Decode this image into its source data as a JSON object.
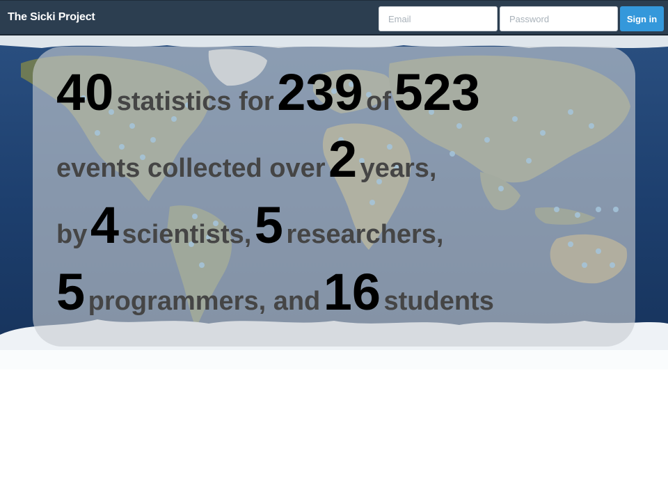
{
  "navbar": {
    "brand": "The Sicki Project",
    "email_placeholder": "Email",
    "password_placeholder": "Password",
    "signin_label": "Sign in"
  },
  "stats": {
    "line1": {
      "n1": "40",
      "t1": "statistics for",
      "n2": "239",
      "t2": "of",
      "n3": "523"
    },
    "line2": {
      "t1": "events collected over",
      "n1": "2",
      "t2": "years,"
    },
    "line3": {
      "t1": "by",
      "n1": "4",
      "t2": "scientists,",
      "n2": "5",
      "t3": "researchers,"
    },
    "line4": {
      "n1": "5",
      "t1": "programmers, and",
      "n2": "16",
      "t2": "students"
    }
  },
  "colors": {
    "navbar_bg": "#2c3e50",
    "signin_bg": "#3498db",
    "ocean": "#1d3f6e",
    "land": "#6e7a55",
    "ice": "#f2f5f8",
    "dot": "#6cb8ea"
  }
}
